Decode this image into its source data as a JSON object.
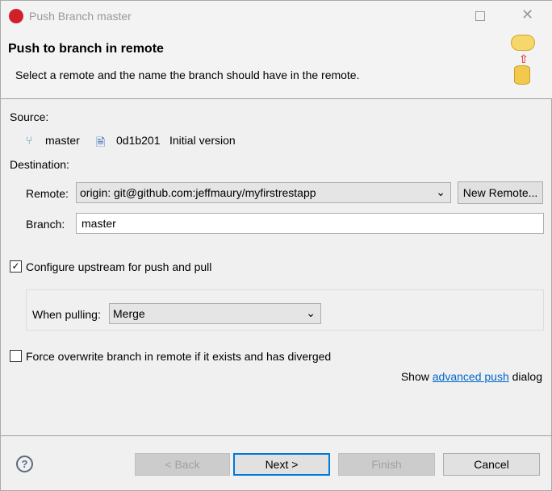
{
  "window": {
    "title": "Push Branch master"
  },
  "header": {
    "title": "Push to branch in remote",
    "description": "Select a remote and the name the branch should have in the remote."
  },
  "source": {
    "label": "Source:",
    "branch": "master",
    "commit_id": "0d1b201",
    "commit_message": "Initial version"
  },
  "destination": {
    "label": "Destination:",
    "remote_label": "Remote:",
    "remote_value": "origin: git@github.com:jeffmaury/myfirstrestapp",
    "new_remote": "New Remote...",
    "branch_label": "Branch:",
    "branch_value": "master"
  },
  "upstream": {
    "label": "Configure upstream for push and pull",
    "checked": true,
    "when_pulling_label": "When pulling:",
    "when_pulling_value": "Merge"
  },
  "force": {
    "label": "Force overwrite branch in remote if it exists and has diverged",
    "checked": false
  },
  "advanced": {
    "prefix": "Show",
    "link": "advanced push",
    "suffix": "dialog"
  },
  "buttons": {
    "back": "< Back",
    "next": "Next >",
    "finish": "Finish",
    "cancel": "Cancel"
  }
}
